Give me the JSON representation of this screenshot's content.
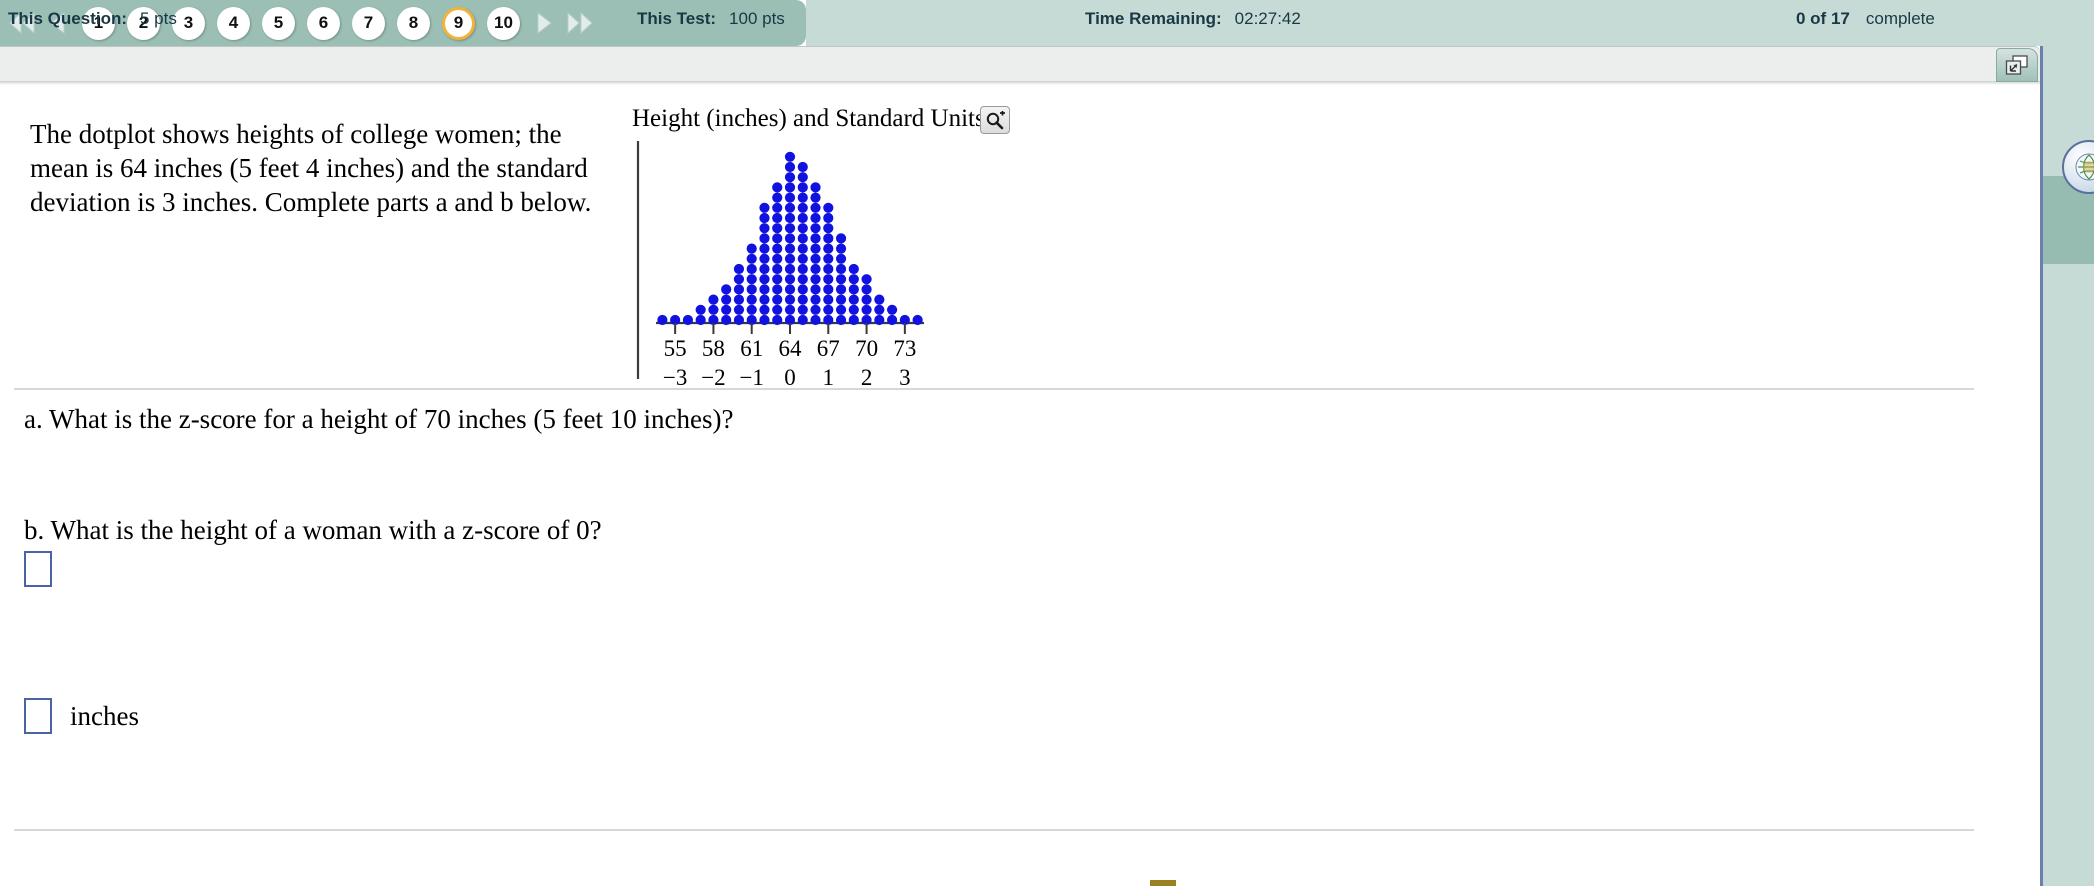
{
  "pager": {
    "first_label": "first-page",
    "prev_label": "previous-page",
    "next_label": "next-page",
    "last_label": "last-page",
    "pages": [
      "1",
      "2",
      "3",
      "4",
      "5",
      "6",
      "7",
      "8",
      "9",
      "10"
    ],
    "current_page": "9",
    "current_color": "#f2b33d",
    "bar_color": "#9bbfb4"
  },
  "status": {
    "question_label": "This Question:",
    "question_value": "5 pts",
    "test_label": "This Test:",
    "test_value": "100 pts",
    "time_label": "Time Remaining:",
    "time_value": "02:27:42",
    "complete_count": "0 of 17",
    "complete_word": "complete",
    "popout_icon": "popout-window-icon"
  },
  "question": {
    "prompt": "The dotplot shows heights of college women; the mean is 64 inches (5 feet 4 inches) and the standard deviation is 3 inches. Complete parts a and b below.",
    "part_a": "a. What is the z-score for a height of 70 inches (5 feet 10 inches)?",
    "part_b": "b. What is the height of a woman with a z-score of 0?",
    "answer_a_value": "",
    "answer_b_value": "",
    "answer_b_unit": "inches"
  },
  "figure": {
    "title": "Height (inches) and Standard Units",
    "zoom_icon": "magnifier-plus-icon"
  },
  "chart_data": {
    "type": "bar",
    "title": "Height (inches) and Standard Units",
    "xlabel": "",
    "ylabel": "",
    "grid": false,
    "legend": null,
    "dot_color": "#1212e0",
    "axis_color": "#3a3a3a",
    "xtick_labels_primary": [
      "55",
      "58",
      "61",
      "64",
      "67",
      "70",
      "73"
    ],
    "xtick_labels_secondary": [
      "−3",
      "−2",
      "−1",
      "0",
      "1",
      "2",
      "3"
    ],
    "xtick_positions": [
      55,
      58,
      61,
      64,
      67,
      70,
      73
    ],
    "x_axis_min": 53.5,
    "x_axis_max": 74.5,
    "stack_note": "each dot = 1 observation; counts are dot-column heights read off the plot",
    "categories": [
      54,
      55,
      56,
      57,
      58,
      59,
      60,
      61,
      62,
      63,
      64,
      65,
      66,
      67,
      68,
      69,
      70,
      71,
      72,
      73,
      74
    ],
    "values": [
      1,
      1,
      1,
      2,
      3,
      4,
      6,
      8,
      12,
      14,
      17,
      16,
      14,
      12,
      9,
      6,
      5,
      3,
      2,
      1,
      1
    ],
    "ylim": [
      0,
      18
    ]
  },
  "side_rail": {
    "icon": "help-globe-icon"
  }
}
